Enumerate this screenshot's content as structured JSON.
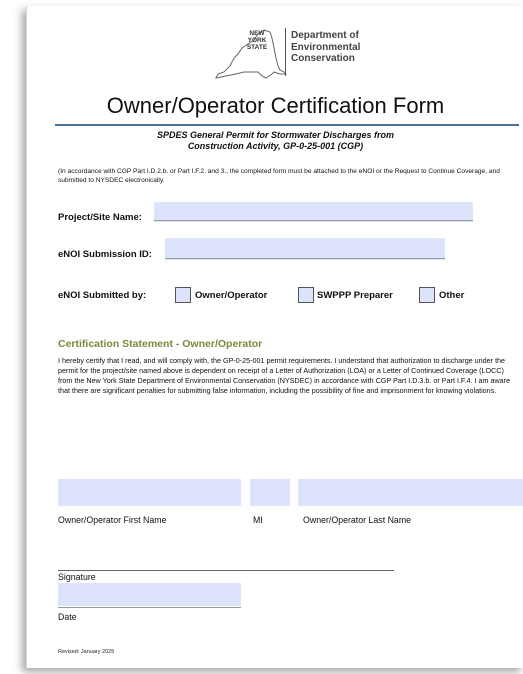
{
  "agency": {
    "state_lines": [
      "NEW",
      "YORK",
      "STATE"
    ],
    "department_lines": [
      "Department of",
      "Environmental",
      "Conservation"
    ]
  },
  "form": {
    "title": "Owner/Operator Certification Form",
    "subtitle_line1": "SPDES General Permit for Stormwater Discharges from",
    "subtitle_line2": "Construction Activity, GP-0-25-001 (CGP)",
    "note": "(In accordance with CGP Part I.D.2.b. or Part I.F.2. and 3., the completed form must be attached to the eNOI or the Request to Continue Coverage, and submitted to NYSDEC electronically."
  },
  "fields": {
    "project_label": "Project/Site Name:",
    "project_value": "",
    "enoi_id_label": "eNOI Submission ID:",
    "enoi_id_value": "",
    "submitted_by_label": "eNOI Submitted by:",
    "submitted_by_options": [
      "Owner/Operator",
      "SWPPP Preparer",
      "Other"
    ]
  },
  "certification": {
    "heading": "Certification Statement - Owner/Operator",
    "text": "I hereby certify that I read, and will comply with, the GP-0-25-001 permit requirements. I understand that authorization to discharge under the permit for the project/site named above is dependent on receipt of a Letter of Authorization (LOA) or a Letter of Continued Coverage (LOCC) from the New York State Department of Environmental Conservation (NYSDEC) in accordance with CGP Part I.D.3.b. or Part I.F.4. I am aware that there are significant penalties for submitting false information, including the possibility of fine and imprisonment for knowing violations."
  },
  "signature_block": {
    "first_name_label": "Owner/Operator First Name",
    "mi_label": "MI",
    "last_name_label": "Owner/Operator Last Name",
    "signature_label": "Signature",
    "date_label": "Date"
  },
  "footer": {
    "revised": "Revised: January 2025"
  },
  "colors": {
    "field_fill": "#dce3fa",
    "title_rule": "#4a6fa0",
    "section_heading": "#7a8a3a"
  }
}
